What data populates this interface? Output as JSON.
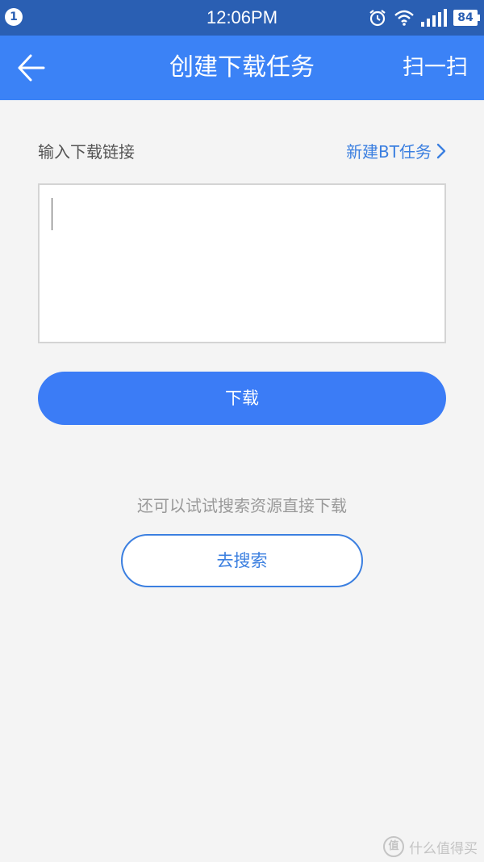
{
  "status_bar": {
    "notification_count": "1",
    "time": "12:06PM",
    "battery": "84",
    "icons": [
      "alarm-icon",
      "wifi-icon",
      "signal-icon",
      "battery-icon"
    ]
  },
  "nav": {
    "back_icon": "back-arrow-icon",
    "title": "创建下载任务",
    "scan_label": "扫一扫"
  },
  "form": {
    "label": "输入下载链接",
    "bt_link": "新建BT任务",
    "bt_link_icon": "chevron-right-icon",
    "input_value": "",
    "download_button": "下载"
  },
  "alt": {
    "hint": "还可以试试搜索资源直接下载",
    "search_button": "去搜索"
  },
  "watermark": {
    "logo": "值",
    "text": "什么值得买"
  },
  "colors": {
    "status_bar": "#2a5fb3",
    "nav_bar": "#3b82f6",
    "accent": "#3b7cf6",
    "link": "#3b7fe0",
    "background": "#f4f4f4"
  }
}
